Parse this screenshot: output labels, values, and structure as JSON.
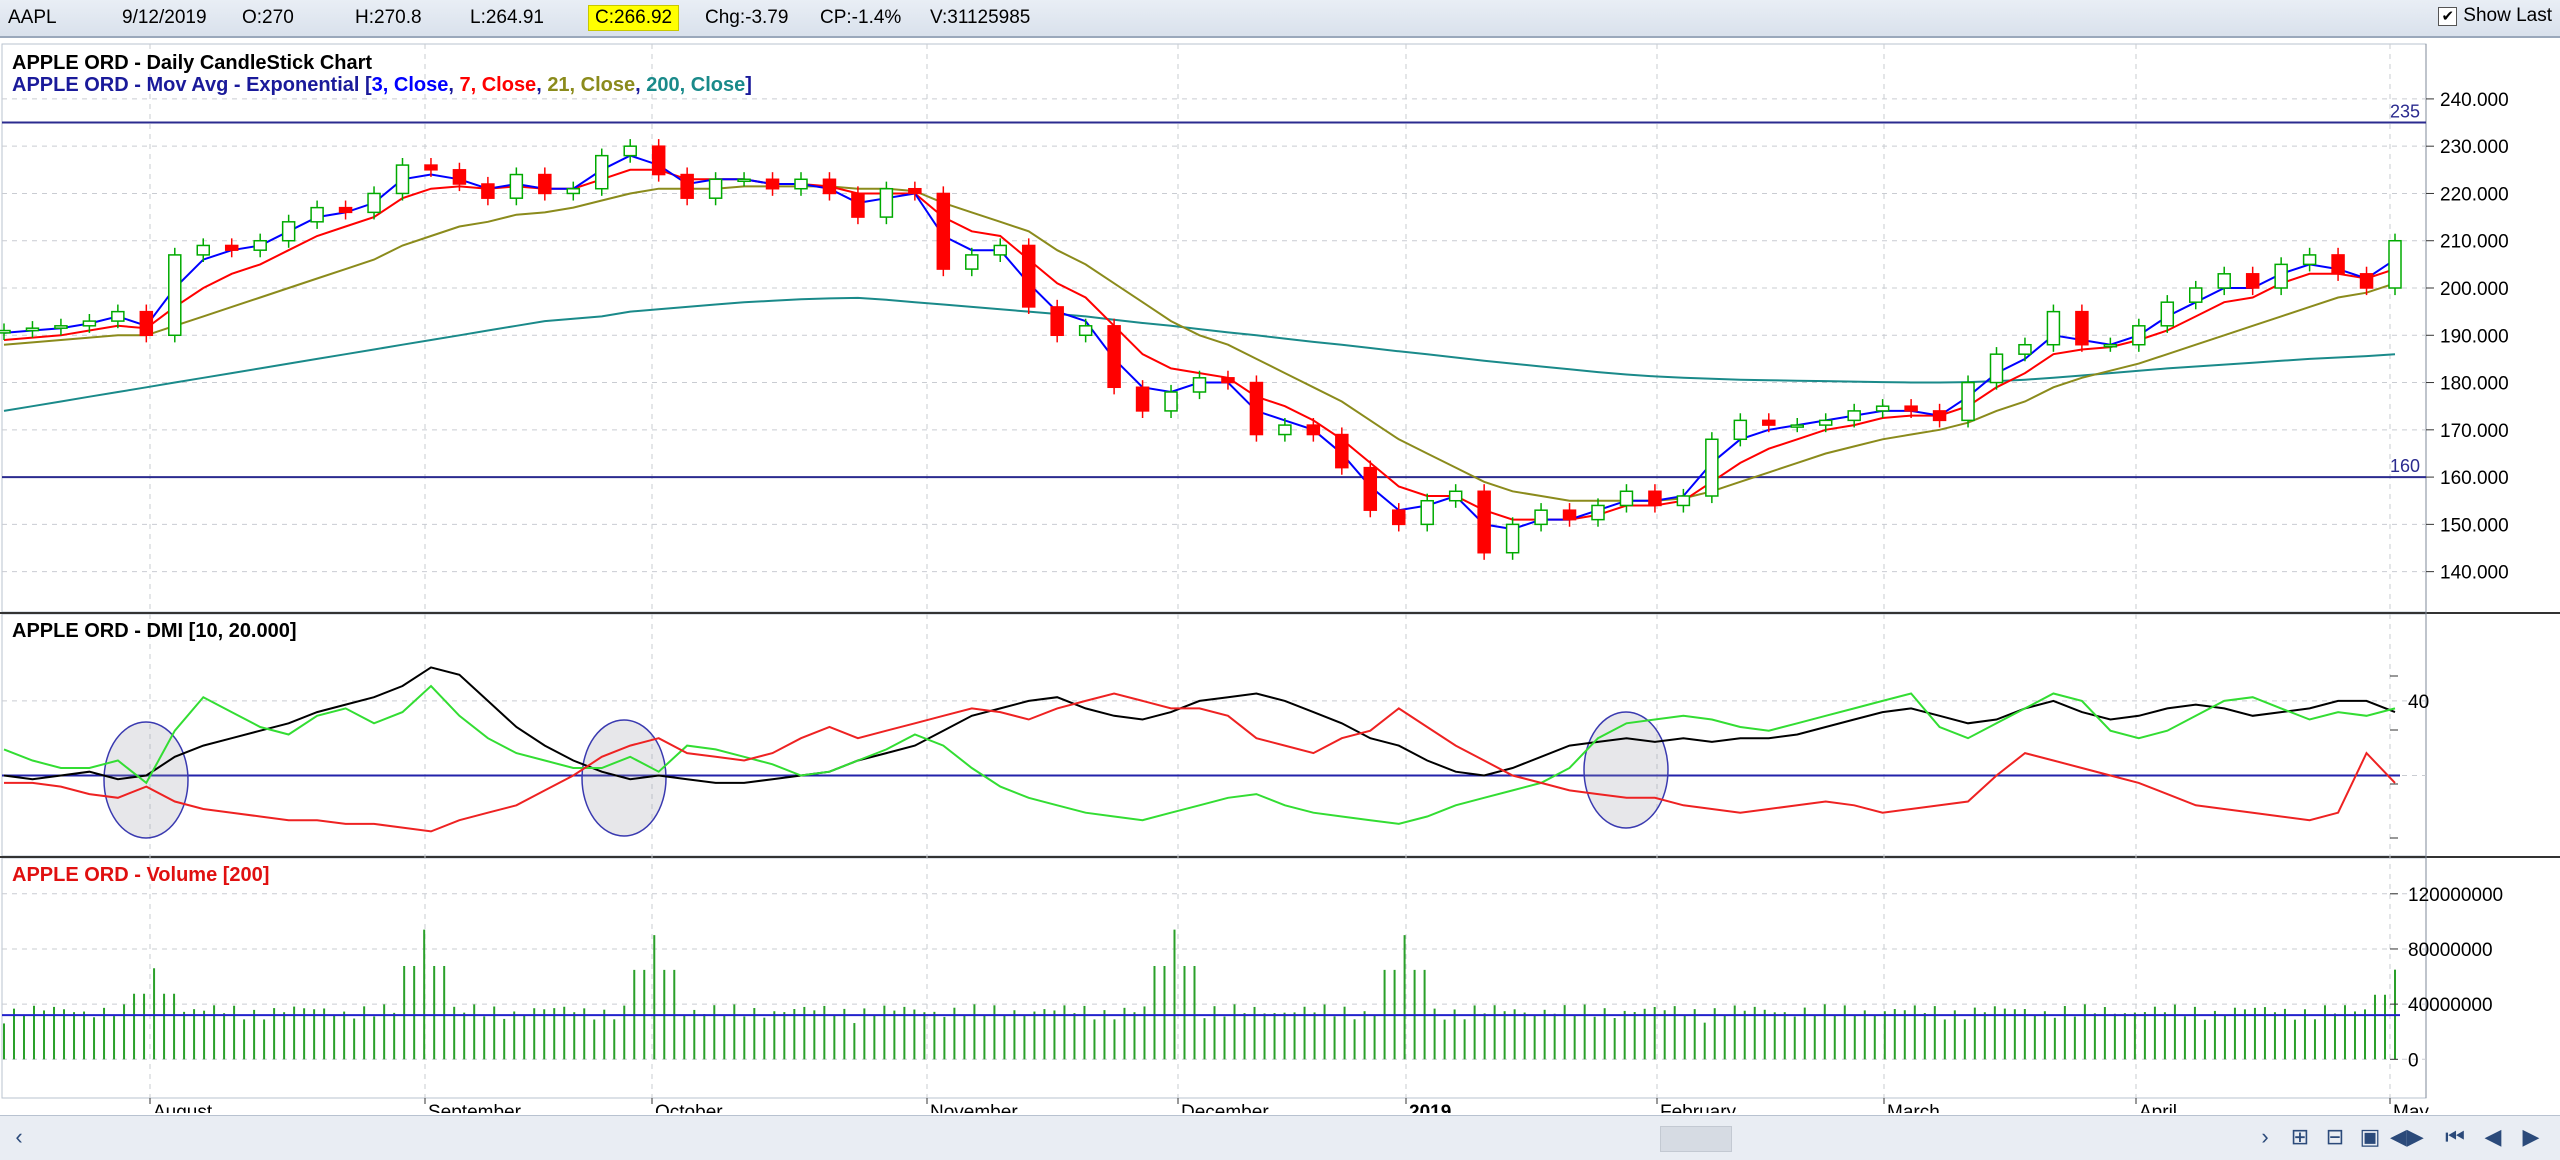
{
  "header": {
    "symbol": "AAPL",
    "date": "9/12/2019",
    "open": "O:270",
    "high": "H:270.8",
    "low": "L:264.91",
    "close": "C:266.92",
    "change": "Chg:-3.79",
    "change_pct": "CP:-1.4%",
    "volume": "V:31125985",
    "show_last_label": "Show Last",
    "show_last_checked": true
  },
  "panels": {
    "price": {
      "title": "APPLE ORD - Daily CandleStick Chart",
      "ma_prefix": "APPLE ORD - Mov Avg - Exponential [",
      "ma_params": [
        "3, Close",
        "7, Close",
        "21, Close",
        "200, Close"
      ],
      "ma_colors": [
        "#0000ff",
        "#ff0000",
        "#8b8b1c",
        "#1a8a8a"
      ],
      "ma_suffix": "]",
      "hlines": [
        {
          "value": 235,
          "label": "235"
        },
        {
          "value": 160,
          "label": "160"
        }
      ]
    },
    "dmi": {
      "title": "APPLE ORD - DMI [10, 20.000]",
      "level_label": "40"
    },
    "volume": {
      "title": "APPLE ORD - Volume [200]"
    }
  },
  "months": [
    "August",
    "September",
    "October",
    "November",
    "December",
    "2019",
    "February",
    "March",
    "April",
    "May"
  ],
  "colors": {
    "up": "#00aa00",
    "down": "#ff0000",
    "adx": "#000000",
    "plus_di": "#33dd33",
    "minus_di": "#ee2222",
    "hline": "#2b2b8f",
    "vol_bar": "#2aa02a",
    "vol_avg": "#2222cc"
  },
  "chart_data": [
    {
      "type": "candlestick",
      "title": "APPLE ORD - Daily CandleStick Chart",
      "y_ticks": [
        "240.000",
        "230.000",
        "220.000",
        "210.000",
        "200.000",
        "190.000",
        "180.000",
        "170.000",
        "160.000",
        "150.000",
        "140.000"
      ],
      "ylim": [
        134,
        244
      ],
      "x_labels": [
        "August",
        "September",
        "October",
        "November",
        "December",
        "2019",
        "February",
        "March",
        "April",
        "May"
      ],
      "series": [
        {
          "name": "Close",
          "values": [
            191,
            191.5,
            192,
            193,
            195,
            190,
            207,
            209,
            208,
            210,
            214,
            217,
            216,
            220,
            226,
            225,
            222,
            219,
            224,
            220,
            221,
            228,
            230,
            224,
            219,
            223,
            223,
            221,
            223,
            220,
            215,
            221,
            220,
            204,
            207,
            209,
            196,
            190,
            192,
            179,
            174,
            178,
            181,
            180,
            169,
            171,
            169,
            162,
            153,
            150,
            155,
            157,
            144,
            150,
            153,
            151,
            154,
            157,
            154,
            156,
            168,
            172,
            171,
            171,
            172,
            174,
            175,
            174,
            172,
            180,
            186,
            188,
            195,
            188,
            188,
            192,
            197,
            200,
            203,
            200,
            205,
            207,
            203,
            200,
            210
          ]
        },
        {
          "name": "3, Close",
          "values": [
            190.5,
            191,
            191.5,
            192.5,
            194,
            192,
            200,
            206,
            208,
            209,
            212,
            215,
            216,
            218,
            223,
            224,
            223,
            221,
            222,
            221,
            221,
            225,
            228,
            226,
            222,
            223,
            223,
            222,
            222,
            221,
            218,
            219,
            220,
            211,
            208,
            208,
            201,
            195,
            193,
            185,
            179,
            178,
            180,
            180,
            174,
            172,
            170,
            165,
            158,
            153,
            154,
            156,
            150,
            149,
            151,
            151,
            153,
            155,
            155,
            156,
            163,
            168,
            170,
            171,
            172,
            173,
            174,
            174,
            173,
            177,
            182,
            185,
            190,
            189,
            188,
            190,
            194,
            197,
            200,
            200,
            203,
            205,
            204,
            202,
            206
          ]
        },
        {
          "name": "7, Close",
          "values": [
            189,
            189.5,
            190,
            191,
            192,
            191.5,
            196,
            200,
            203,
            205,
            208,
            211,
            213,
            215,
            219,
            221,
            221.5,
            221,
            221.5,
            221,
            221,
            223,
            225,
            225,
            223,
            223,
            223,
            222,
            222,
            221.5,
            220,
            220,
            220,
            215,
            212,
            211,
            206,
            201,
            198,
            192,
            186,
            183,
            182,
            181,
            177,
            175,
            172,
            168,
            163,
            158,
            156,
            156,
            153,
            151,
            151,
            151,
            152,
            154,
            154,
            155,
            159,
            163,
            166,
            168,
            170,
            171,
            172.5,
            173,
            173,
            175,
            179,
            182,
            186,
            187,
            187.5,
            189,
            191,
            194,
            197,
            198,
            201,
            203,
            203,
            202,
            204
          ]
        },
        {
          "name": "21, Close",
          "values": [
            188,
            188.5,
            189,
            189.5,
            190,
            190,
            192,
            194,
            196,
            198,
            200,
            202,
            204,
            206,
            209,
            211,
            213,
            214,
            215.5,
            216,
            217,
            218.5,
            220,
            221,
            221,
            221,
            221.5,
            221.5,
            221.5,
            221.5,
            221,
            221,
            220.5,
            218,
            216,
            214,
            212,
            208,
            205,
            201,
            197,
            193,
            190,
            188,
            185,
            182,
            179,
            176,
            172,
            168,
            165,
            162,
            159,
            157,
            156,
            155,
            155,
            155,
            155,
            155.5,
            157,
            159,
            161,
            163,
            165,
            166.5,
            168,
            169,
            170,
            171.5,
            174,
            176,
            179,
            181,
            182.5,
            184,
            186,
            188,
            190,
            192,
            194,
            196,
            198,
            199,
            201
          ]
        },
        {
          "name": "200, Close",
          "values": [
            174,
            175,
            176,
            177,
            178,
            179,
            180,
            181,
            182,
            183,
            184,
            185,
            186,
            187,
            188,
            189,
            190,
            191,
            192,
            193,
            193.5,
            194,
            195,
            195.5,
            196,
            196.5,
            197,
            197.3,
            197.6,
            197.8,
            197.9,
            197.5,
            197,
            196.5,
            196,
            195.5,
            195,
            194.5,
            194,
            193.3,
            192.6,
            192,
            191.3,
            190.6,
            190,
            189.3,
            188.6,
            188,
            187.3,
            186.6,
            186,
            185.3,
            184.6,
            184,
            183.4,
            182.8,
            182.2,
            181.7,
            181.3,
            181,
            180.8,
            180.6,
            180.5,
            180.4,
            180.3,
            180.2,
            180.1,
            180,
            180,
            180.1,
            180.3,
            180.6,
            181,
            181.5,
            182,
            182.5,
            183,
            183.4,
            183.8,
            184.2,
            184.6,
            185,
            185.3,
            185.6,
            186
          ]
        }
      ],
      "hlines": [
        235,
        160
      ]
    },
    {
      "type": "line",
      "title": "APPLE ORD - DMI [10, 20.000]",
      "y_ticks": [
        "40"
      ],
      "ylim": [
        0,
        55
      ],
      "reference_line": 20,
      "series": [
        {
          "name": "ADX",
          "values": [
            20,
            19,
            20,
            21,
            19,
            20,
            25,
            28,
            30,
            32,
            34,
            37,
            39,
            41,
            44,
            49,
            47,
            40,
            33,
            28,
            24,
            21,
            19,
            20,
            19,
            18,
            18,
            19,
            20,
            21,
            24,
            26,
            28,
            32,
            36,
            38,
            40,
            41,
            38,
            36,
            35,
            37,
            40,
            41,
            42,
            40,
            37,
            34,
            30,
            28,
            24,
            21,
            20,
            22,
            25,
            28,
            29,
            30,
            29,
            30,
            29,
            30,
            30,
            31,
            33,
            35,
            37,
            38,
            36,
            34,
            35,
            38,
            40,
            37,
            35,
            36,
            38,
            39,
            38,
            36,
            37,
            38,
            40,
            40,
            37
          ]
        },
        {
          "name": "+DI",
          "values": [
            27,
            24,
            22,
            22,
            24,
            18,
            32,
            41,
            37,
            33,
            31,
            36,
            38,
            34,
            37,
            44,
            36,
            30,
            26,
            24,
            22,
            22,
            25,
            21,
            28,
            27,
            25,
            23,
            20,
            21,
            24,
            27,
            31,
            28,
            22,
            17,
            14,
            12,
            10,
            9,
            8,
            10,
            12,
            14,
            15,
            12,
            10,
            9,
            8,
            7,
            9,
            12,
            14,
            16,
            18,
            22,
            30,
            34,
            35,
            36,
            35,
            33,
            32,
            34,
            36,
            38,
            40,
            42,
            33,
            30,
            34,
            38,
            42,
            40,
            32,
            30,
            32,
            36,
            40,
            41,
            38,
            35,
            37,
            36,
            38
          ]
        },
        {
          "name": "-DI",
          "values": [
            18,
            18,
            17,
            15,
            14,
            17,
            13,
            11,
            10,
            9,
            8,
            8,
            7,
            7,
            6,
            5,
            8,
            10,
            12,
            16,
            20,
            25,
            28,
            30,
            26,
            25,
            24,
            26,
            30,
            33,
            30,
            32,
            34,
            36,
            38,
            37,
            35,
            38,
            40,
            42,
            40,
            38,
            38,
            36,
            30,
            28,
            26,
            30,
            32,
            38,
            33,
            28,
            24,
            20,
            18,
            16,
            15,
            14,
            14,
            12,
            11,
            10,
            11,
            12,
            13,
            12,
            10,
            11,
            12,
            13,
            20,
            26,
            24,
            22,
            20,
            18,
            15,
            12,
            11,
            10,
            9,
            8,
            10,
            26,
            18
          ]
        }
      ]
    },
    {
      "type": "bar",
      "title": "APPLE ORD - Volume [200]",
      "y_ticks": [
        "120000000",
        "80000000",
        "40000000",
        "0"
      ],
      "ylim": [
        -15000000,
        130000000
      ],
      "moving_average": 32000000,
      "peaks": [
        {
          "x_label": "August",
          "value": 66000000
        },
        {
          "x_label": "September",
          "value": 94000000
        },
        {
          "x_label": "October",
          "value": 90000000
        },
        {
          "x_label": "December",
          "value": 94000000
        },
        {
          "x_label": "2019",
          "value": 90000000
        },
        {
          "x_label": "May",
          "value": 65000000
        }
      ]
    }
  ]
}
